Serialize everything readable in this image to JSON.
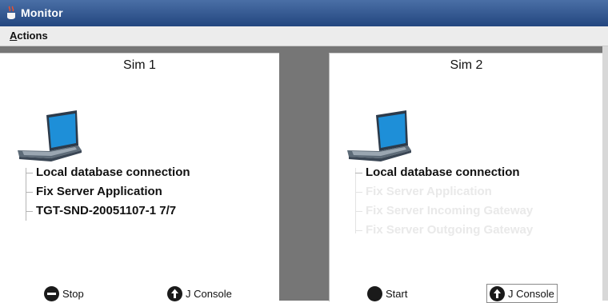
{
  "window": {
    "title": "Monitor",
    "icon": "coffee-cup-icon"
  },
  "menu": {
    "items": [
      {
        "label_mnemonic": "A",
        "label_rest": "ctions"
      }
    ]
  },
  "sims": [
    {
      "title": "Sim 1",
      "tree": [
        {
          "label": "Local database connection",
          "enabled": true
        },
        {
          "label": "Fix Server Application",
          "enabled": true
        },
        {
          "label": "TGT-SND-20051107-1 7/7",
          "enabled": true
        }
      ],
      "primary_button": {
        "label": "Stop",
        "icon": "stop-icon"
      },
      "console_button": {
        "label": "J Console",
        "icon": "upload-arrow-icon"
      }
    },
    {
      "title": "Sim 2",
      "tree": [
        {
          "label": "Local database connection",
          "enabled": true
        },
        {
          "label": "Fix Server Application",
          "enabled": false
        },
        {
          "label": "Fix Server Incoming Gateway",
          "enabled": false
        },
        {
          "label": "Fix Server Outgoing Gateway",
          "enabled": false
        }
      ],
      "primary_button": {
        "label": "Start",
        "icon": "start-icon"
      },
      "console_button": {
        "label": "J Console",
        "icon": "upload-arrow-icon"
      }
    }
  ],
  "colors": {
    "titlebar": "#23467f",
    "workspace": "#767676",
    "laptop_screen": "#1e8fd8",
    "disabled_text": "#e9e9e9"
  }
}
